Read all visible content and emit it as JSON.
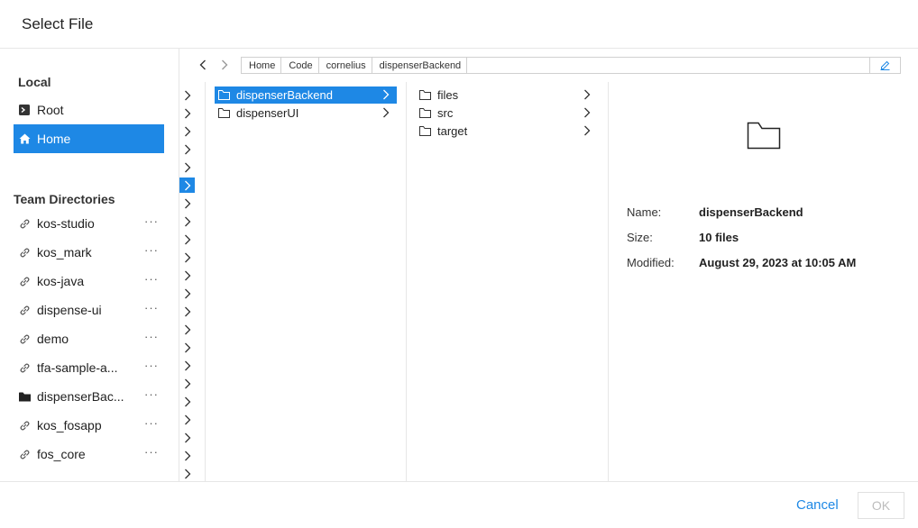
{
  "dialog": {
    "title": "Select File"
  },
  "sidebar": {
    "local_title": "Local",
    "local_items": [
      {
        "label": "Root",
        "icon": "terminal-icon"
      },
      {
        "label": "Home",
        "icon": "home-icon",
        "selected": true
      }
    ],
    "team_title": "Team Directories",
    "team_items": [
      {
        "label": "kos-studio",
        "icon": "link-icon",
        "more": "···"
      },
      {
        "label": "kos_mark",
        "icon": "link-icon",
        "more": "···"
      },
      {
        "label": "kos-java",
        "icon": "link-icon",
        "more": "···"
      },
      {
        "label": "dispense-ui",
        "icon": "link-icon",
        "more": "···"
      },
      {
        "label": "demo",
        "icon": "link-icon",
        "more": "···"
      },
      {
        "label": "tfa-sample-a...",
        "icon": "link-icon",
        "more": "···"
      },
      {
        "label": "dispenserBac...",
        "icon": "folder-filled-icon",
        "more": "···"
      },
      {
        "label": "kos_fosapp",
        "icon": "link-icon",
        "more": "···"
      },
      {
        "label": "fos_core",
        "icon": "link-icon",
        "more": "···"
      }
    ]
  },
  "navigation": {
    "breadcrumb": [
      "Home",
      "Code",
      "cornelius",
      "dispenserBackend"
    ]
  },
  "columns": {
    "column1": [
      {
        "label": "dispenserBackend",
        "selected": true
      },
      {
        "label": "dispenserUI",
        "selected": false
      }
    ],
    "column2": [
      {
        "label": "files"
      },
      {
        "label": "src"
      },
      {
        "label": "target"
      }
    ]
  },
  "details": {
    "name_label": "Name:",
    "name_value": "dispenserBackend",
    "size_label": "Size:",
    "size_value": "10 files",
    "modified_label": "Modified:",
    "modified_value": "August 29, 2023 at 10:05 AM"
  },
  "footer": {
    "cancel_label": "Cancel",
    "ok_label": "OK"
  },
  "colors": {
    "accent": "#1e88e5",
    "disabled_text": "#bdbdbd"
  }
}
